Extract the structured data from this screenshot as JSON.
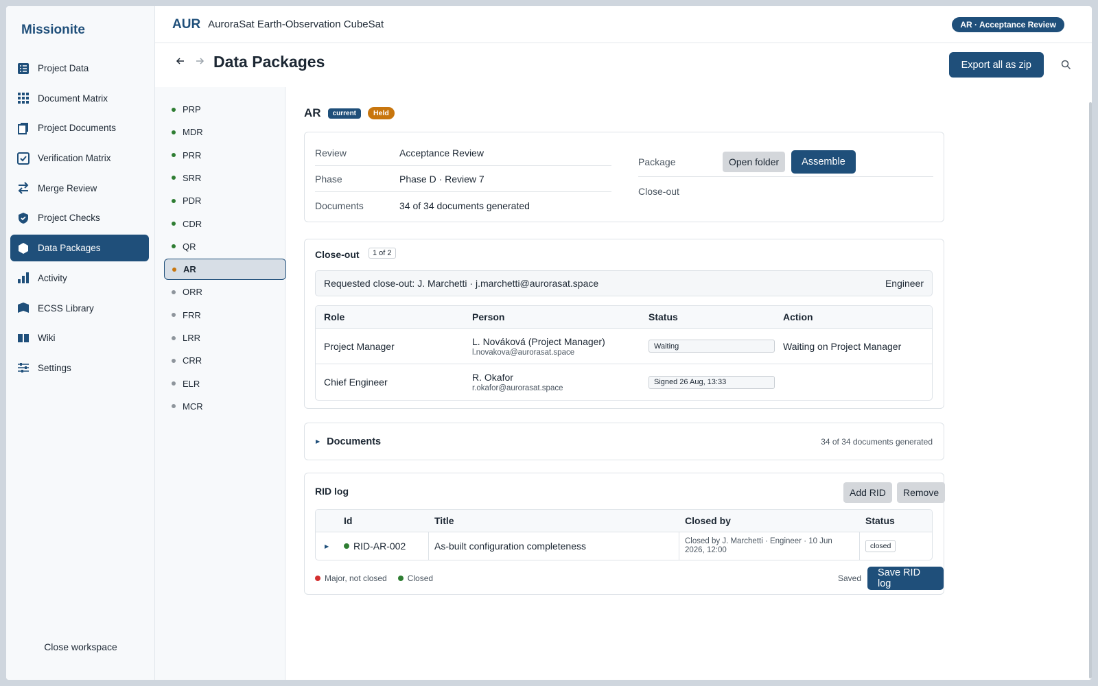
{
  "app": {
    "name": "Missionite"
  },
  "sidebar": {
    "items": [
      {
        "label": "Project Data",
        "icon": "list-icon"
      },
      {
        "label": "Document Matrix",
        "icon": "grid-icon"
      },
      {
        "label": "Project Documents",
        "icon": "documents-icon"
      },
      {
        "label": "Verification Matrix",
        "icon": "checkbox-icon"
      },
      {
        "label": "Merge Review",
        "icon": "swap-arrows-icon"
      },
      {
        "label": "Project Checks",
        "icon": "shield-check-icon"
      },
      {
        "label": "Data Packages",
        "icon": "package-icon"
      },
      {
        "label": "Activity",
        "icon": "bar-chart-icon"
      },
      {
        "label": "ECSS Library",
        "icon": "library-icon"
      },
      {
        "label": "Wiki",
        "icon": "book-icon"
      },
      {
        "label": "Settings",
        "icon": "sliders-icon"
      }
    ],
    "active_index": 6,
    "close_label": "Close workspace"
  },
  "topbar": {
    "project_code": "AUR",
    "project_name": "AuroraSat Earth-Observation CubeSat",
    "review_pill": "AR · Acceptance Review"
  },
  "page": {
    "title": "Data Packages",
    "back_icon": "arrow-left-icon",
    "forward_icon": "arrow-right-icon",
    "export_label": "Export all as zip"
  },
  "reviews": [
    {
      "code": "PRP",
      "state": "done"
    },
    {
      "code": "MDR",
      "state": "done"
    },
    {
      "code": "PRR",
      "state": "done"
    },
    {
      "code": "SRR",
      "state": "done"
    },
    {
      "code": "PDR",
      "state": "done"
    },
    {
      "code": "CDR",
      "state": "done"
    },
    {
      "code": "QR",
      "state": "done"
    },
    {
      "code": "AR",
      "state": "current"
    },
    {
      "code": "ORR",
      "state": "pending"
    },
    {
      "code": "FRR",
      "state": "pending"
    },
    {
      "code": "LRR",
      "state": "pending"
    },
    {
      "code": "CRR",
      "state": "pending"
    },
    {
      "code": "ELR",
      "state": "pending"
    },
    {
      "code": "MCR",
      "state": "pending"
    }
  ],
  "colors": {
    "done": "#2e7d32",
    "current": "#c8760e",
    "pending": "#8e959c",
    "accent": "#1f4f7a",
    "major": "#d32f2f"
  },
  "detail": {
    "code": "AR",
    "badge_current": "current",
    "badge_held": "Held",
    "info": [
      {
        "key": "Review",
        "value": "Acceptance Review"
      },
      {
        "key": "Phase",
        "value": "Phase D · Review 7"
      },
      {
        "key": "Documents",
        "value": "34 of 34 documents generated"
      }
    ],
    "package_label": "Package",
    "open_folder_label": "Open folder",
    "assemble_label": "Assemble",
    "closeout_label": "Close-out"
  },
  "closeout": {
    "title": "Close-out",
    "count": "1 of 2",
    "requested_text": "Requested close-out: J. Marchetti · j.marchetti@aurorasat.space",
    "requested_role": "Engineer",
    "headers": [
      "Role",
      "Person",
      "Status",
      "Action"
    ],
    "rows": [
      {
        "role": "Project Manager",
        "person": "L. Nováková (Project Manager)",
        "email": "l.novakova@aurorasat.space",
        "status": "Waiting",
        "action": "Waiting on Project Manager"
      },
      {
        "role": "Chief Engineer",
        "person": "R. Okafor",
        "email": "r.okafor@aurorasat.space",
        "status": "Signed 26 Aug, 13:33",
        "action": ""
      }
    ]
  },
  "documents": {
    "title": "Documents",
    "summary": "34 of 34 documents generated"
  },
  "rid": {
    "title": "RID log",
    "add_label": "Add RID",
    "remove_label": "Remove",
    "headers": [
      "Id",
      "Title",
      "Closed by",
      "Status"
    ],
    "rows": [
      {
        "id": "RID-AR-002",
        "title": "As-built configuration completeness",
        "closed_by": "Closed by J. Marchetti · Engineer · 10 Jun 2026, 12:00",
        "status": "closed"
      }
    ],
    "legend_major": "Major, not closed",
    "legend_closed": "Closed",
    "saved_label": "Saved",
    "save_label": "Save RID log"
  }
}
